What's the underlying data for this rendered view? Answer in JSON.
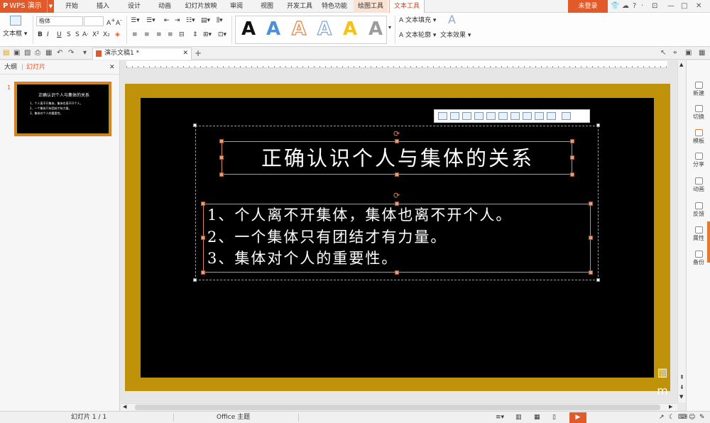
{
  "app": {
    "name": "WPS 演示",
    "login_label": "未登录"
  },
  "menu_tabs": [
    "开始",
    "插入",
    "设计",
    "动画",
    "幻灯片放映",
    "审阅",
    "视图",
    "开发工具",
    "特色功能",
    "绘图工具",
    "文本工具"
  ],
  "ribbon": {
    "textbox_label": "文本框",
    "font_name": "楷体",
    "font_size": "",
    "wordart_fill_label": "文本填充",
    "wordart_outline_label": "文本轮廓",
    "wordart_effect_label": "文本效果",
    "gallery_letter": "A",
    "gallery_colors": [
      "#111111",
      "#4f8fd6",
      "#f0a070",
      "#9fb9e8",
      "#f4c21a",
      "#a0a0a0"
    ]
  },
  "document_tab": {
    "title": "演示文稿1 *"
  },
  "left_pane": {
    "tabs": [
      "大纲",
      "幻灯片"
    ],
    "slide_number": "1"
  },
  "slide": {
    "title": "正确认识个人与集体的关系",
    "body_lines": [
      "1、个人离不开集体，集体也离不开个人。",
      "2、一个集体只有团结才有力量。",
      "3、集体对个人的重要性。"
    ],
    "frame_color": "#c0920a",
    "background_color": "#000000"
  },
  "side_panel": [
    "新建",
    "切换",
    "模板",
    "分享",
    "动画",
    "反馈",
    "属性",
    "备份"
  ],
  "status": {
    "slide_counter": "幻灯片 1 / 1",
    "theme_label": "Office 主题"
  },
  "colors": {
    "accent": "#e2592a",
    "selection": "#e08a56"
  }
}
